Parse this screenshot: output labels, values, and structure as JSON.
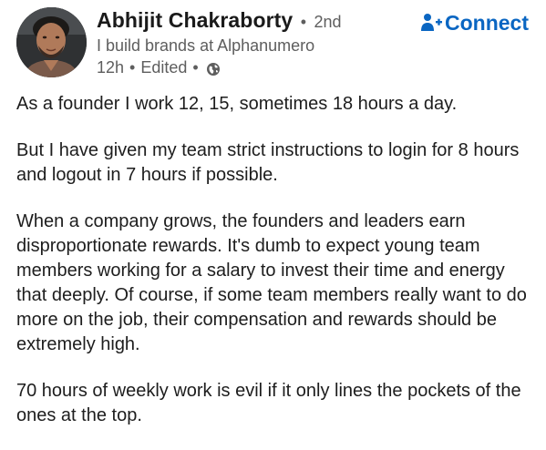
{
  "post": {
    "author": {
      "name": "Abhijit Chakraborty",
      "degree": "2nd",
      "headline": "I build brands at Alphanumero",
      "time": "12h",
      "edited": "Edited",
      "separator": "•",
      "visibility_icon": "globe-icon",
      "avatar_icon": "profile-photo"
    },
    "connect": {
      "label": "Connect",
      "icon": "add-person-icon",
      "color": "#0a66c2"
    },
    "paragraphs": [
      "As a founder I work 12, 15, sometimes 18 hours a day.",
      "But I have given my team strict instructions to login for 8 hours and logout in 7 hours if possible.",
      "When a company grows, the founders and leaders earn disproportionate rewards. It's dumb to expect young team members working for a salary to invest their time and energy that deeply. Of course, if some team members really want to do more on the job, their compensation and rewards should be extremely high.",
      "70 hours of weekly work is evil if it only lines the pockets of the ones at the top."
    ]
  }
}
